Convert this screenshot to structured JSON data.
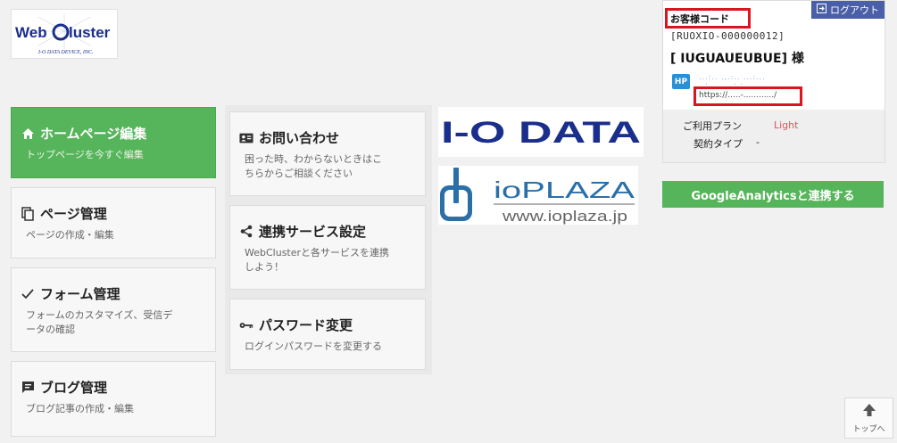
{
  "logo": {
    "text_left": "Web",
    "text_right": "luster",
    "tagline": "I-O DATA DEVICE, INC."
  },
  "menu": {
    "home": {
      "title": "ホームページ編集",
      "desc": "トップページを今すぐ編集",
      "icon": "home-icon"
    },
    "page": {
      "title": "ページ管理",
      "desc": "ページの作成・編集",
      "icon": "copy-icon"
    },
    "form": {
      "title": "フォーム管理",
      "desc_line1": "フォームのカスタマイズ、受信デ",
      "desc_line2": "ータの確認",
      "icon": "check-icon"
    },
    "blog": {
      "title": "ブログ管理",
      "desc": "ブログ記事の作成・編集",
      "icon": "comment-icon"
    },
    "contact": {
      "title": "お問い合わせ",
      "desc_line1": "困った時、わからないときはこ",
      "desc_line2": "ちらからご相談ください",
      "icon": "contact-card-icon"
    },
    "service": {
      "title": "連携サービス設定",
      "desc_line1": "WebClusterと各サービスを連携",
      "desc_line2": "しよう！",
      "icon": "share-icon"
    },
    "password": {
      "title": "パスワード変更",
      "desc": "ログインパスワードを変更する",
      "icon": "key-icon"
    }
  },
  "partners": {
    "iodata": "I-O DATA",
    "ioplaza_title": "ioPLAZA",
    "ioplaza_url": "www.ioplaza.jp"
  },
  "account": {
    "logout_label": "ログアウト",
    "customer_code_label": "お客様コード",
    "customer_code": "[RUOXIO-000000012]",
    "customer_name": "[ IUGUAUEUBUE] 様",
    "hp_badge": "HP",
    "hp_desc_line1": "...:.. .,.:.. ...:...",
    "hp_desc_line2": "..:.. .....: :... . ..",
    "hp_url": "https://.....-............/",
    "plan_label": "ご利用プラン",
    "plan_value": "Light",
    "contract_label": "契約タイプ",
    "contract_value": "-"
  },
  "ga_button": "GoogleAnalyticsと連携する",
  "to_top": "トップへ",
  "colors": {
    "green": "#56b45a",
    "navy": "#1a2e8c",
    "highlight_red": "#d9151e",
    "ioplaza_blue": "#2b6fa8"
  }
}
